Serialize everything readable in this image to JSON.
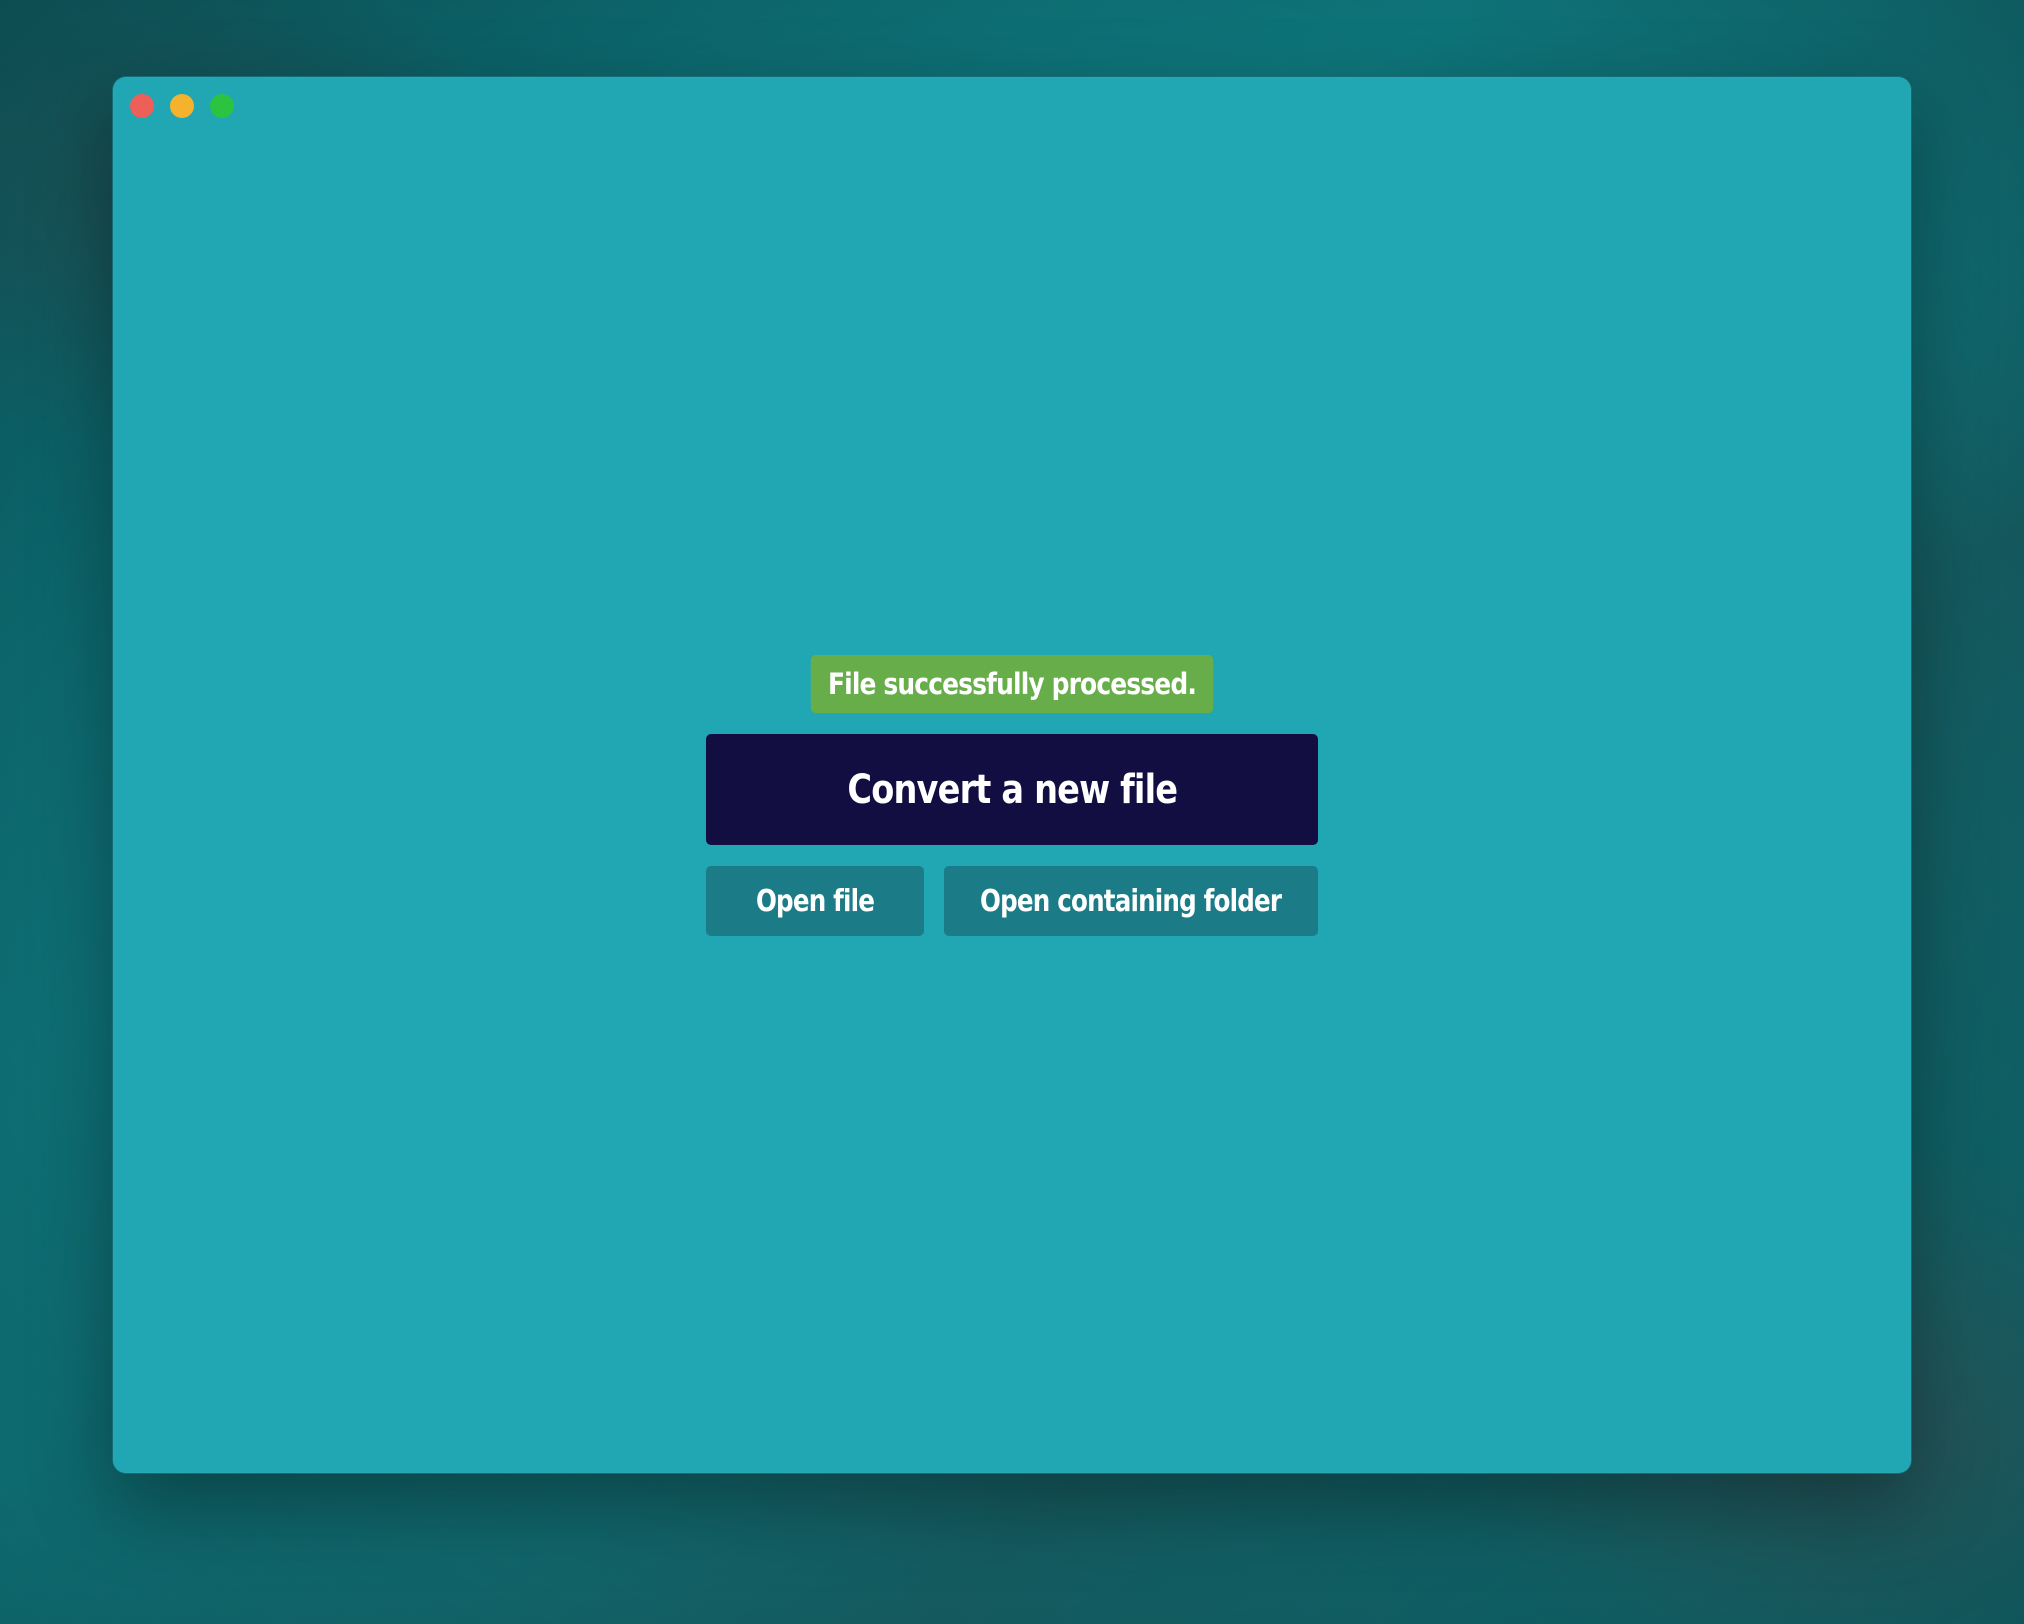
{
  "window": {
    "background_color": "#21a6b3",
    "traffic_lights": [
      {
        "name": "close",
        "color": "#ee5f57"
      },
      {
        "name": "minimize",
        "color": "#f5b32d"
      },
      {
        "name": "zoom",
        "color": "#2cc341"
      }
    ]
  },
  "status": {
    "message": "File successfully processed.",
    "color": "#67ad4a"
  },
  "actions": {
    "convert_label": "Convert a new file",
    "convert_color": "#120e42",
    "open_file_label": "Open file",
    "open_folder_label": "Open containing folder",
    "secondary_color": "#1b7c87"
  }
}
